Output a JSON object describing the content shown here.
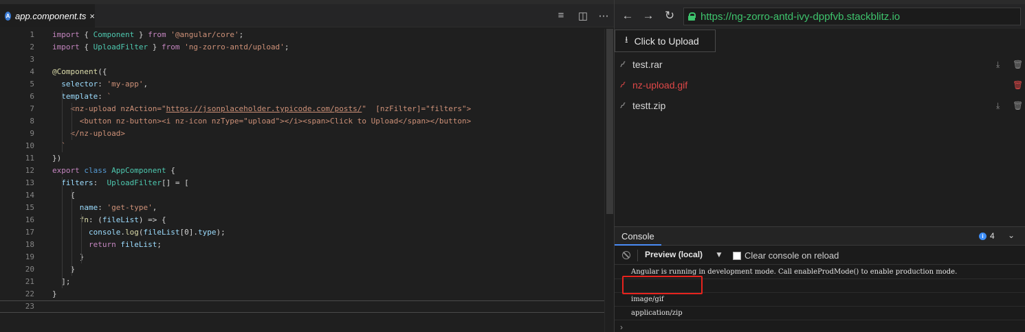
{
  "editor": {
    "tab": {
      "icon_letter": "A",
      "label": "app.component.ts",
      "close": "×"
    },
    "actions": {
      "outline": "≡",
      "split": "◫",
      "more": "⋯"
    },
    "lines": [
      {
        "n": "1",
        "tokens": [
          [
            "k",
            "import"
          ],
          [
            "p",
            " { "
          ],
          [
            "t",
            "Component"
          ],
          [
            "p",
            " } "
          ],
          [
            "k",
            "from"
          ],
          [
            "p",
            " "
          ],
          [
            "s",
            "'@angular/core'"
          ],
          [
            "p",
            ";"
          ]
        ]
      },
      {
        "n": "2",
        "tokens": [
          [
            "k",
            "import"
          ],
          [
            "p",
            " { "
          ],
          [
            "t",
            "UploadFilter"
          ],
          [
            "p",
            " } "
          ],
          [
            "k",
            "from"
          ],
          [
            "p",
            " "
          ],
          [
            "s",
            "'ng-zorro-antd/upload'"
          ],
          [
            "p",
            ";"
          ]
        ]
      },
      {
        "n": "3",
        "tokens": []
      },
      {
        "n": "4",
        "tokens": [
          [
            "f",
            "@Component"
          ],
          [
            "p",
            "({"
          ]
        ]
      },
      {
        "n": "5",
        "tokens": [
          [
            "p",
            "  "
          ],
          [
            "v",
            "selector"
          ],
          [
            "p",
            ": "
          ],
          [
            "s",
            "'my-app'"
          ],
          [
            "p",
            ","
          ]
        ]
      },
      {
        "n": "6",
        "tokens": [
          [
            "p",
            "  "
          ],
          [
            "v",
            "template"
          ],
          [
            "p",
            ": "
          ],
          [
            "s",
            "`"
          ]
        ]
      },
      {
        "n": "7",
        "tokens": [
          [
            "p",
            "    "
          ],
          [
            "tag",
            "<nz-upload nzAction=\""
          ],
          [
            "u",
            "https://jsonplaceholder.typicode.com/posts/"
          ],
          [
            "tag",
            "\"  [nzFilter]=\"filters\">"
          ]
        ]
      },
      {
        "n": "8",
        "tokens": [
          [
            "p",
            "      "
          ],
          [
            "tag",
            "<button nz-button><i nz-icon nzType=\"upload\"></i><span>Click to Upload</span></button>"
          ]
        ]
      },
      {
        "n": "9",
        "tokens": [
          [
            "p",
            "    "
          ],
          [
            "tag",
            "</nz-upload>"
          ]
        ]
      },
      {
        "n": "10",
        "tokens": [
          [
            "p",
            "  "
          ],
          [
            "s",
            "`"
          ]
        ]
      },
      {
        "n": "11",
        "tokens": [
          [
            "p",
            "})"
          ]
        ]
      },
      {
        "n": "12",
        "tokens": [
          [
            "k",
            "export"
          ],
          [
            "p",
            " "
          ],
          [
            "kb",
            "class"
          ],
          [
            "p",
            " "
          ],
          [
            "t",
            "AppComponent"
          ],
          [
            "p",
            " {"
          ]
        ]
      },
      {
        "n": "13",
        "tokens": [
          [
            "p",
            "  "
          ],
          [
            "v",
            "filters"
          ],
          [
            "p",
            ":  "
          ],
          [
            "t",
            "UploadFilter"
          ],
          [
            "p",
            "[] = ["
          ]
        ]
      },
      {
        "n": "14",
        "tokens": [
          [
            "p",
            "    {"
          ]
        ]
      },
      {
        "n": "15",
        "tokens": [
          [
            "p",
            "      "
          ],
          [
            "v",
            "name"
          ],
          [
            "p",
            ": "
          ],
          [
            "s",
            "'get-type'"
          ],
          [
            "p",
            ","
          ]
        ]
      },
      {
        "n": "16",
        "tokens": [
          [
            "p",
            "      "
          ],
          [
            "f",
            "fn"
          ],
          [
            "p",
            ": ("
          ],
          [
            "v",
            "fileList"
          ],
          [
            "p",
            ") => {"
          ]
        ]
      },
      {
        "n": "17",
        "tokens": [
          [
            "p",
            "        "
          ],
          [
            "v",
            "console"
          ],
          [
            "p",
            "."
          ],
          [
            "f",
            "log"
          ],
          [
            "p",
            "("
          ],
          [
            "v",
            "fileList"
          ],
          [
            "p",
            "[0]."
          ],
          [
            "v",
            "type"
          ],
          [
            "p",
            ");"
          ]
        ]
      },
      {
        "n": "18",
        "tokens": [
          [
            "p",
            "        "
          ],
          [
            "k",
            "return"
          ],
          [
            "p",
            " "
          ],
          [
            "v",
            "fileList"
          ],
          [
            "p",
            ";"
          ]
        ]
      },
      {
        "n": "19",
        "tokens": [
          [
            "p",
            "      }"
          ]
        ]
      },
      {
        "n": "20",
        "tokens": [
          [
            "p",
            "    }"
          ]
        ]
      },
      {
        "n": "21",
        "tokens": [
          [
            "p",
            "  ];"
          ]
        ]
      },
      {
        "n": "22",
        "tokens": [
          [
            "p",
            "}"
          ]
        ]
      },
      {
        "n": "23",
        "tokens": []
      }
    ]
  },
  "browser": {
    "back": "←",
    "forward": "→",
    "reload": "↻",
    "url": "https://ng-zorro-antd-ivy-dppfvb.stackblitz.io"
  },
  "page": {
    "upload_label": "Click to Upload",
    "upload_icon": "⭳",
    "files": [
      {
        "name": "test.rar",
        "status": "normal"
      },
      {
        "name": "nz-upload.gif",
        "status": "error"
      },
      {
        "name": "testt.zip",
        "status": "normal"
      }
    ],
    "icons": {
      "clip": "⌇",
      "download": "⤓",
      "delete": "🗑"
    }
  },
  "console": {
    "tab_label": "Console",
    "badge_icon": "i",
    "badge_count": "4",
    "collapse": "⌄",
    "context": "Preview (local)",
    "context_arrow": "▼",
    "clear_label": "Clear console on reload",
    "messages": [
      "Angular is running in development mode. Call enableProdMode() to enable production mode.",
      "",
      "image/gif",
      "application/zip"
    ],
    "prompt": "›"
  },
  "colors": {
    "accent": "#3e8ef7",
    "error": "#e04848",
    "secure": "#3ec46d",
    "highlight": "#e8231d"
  }
}
